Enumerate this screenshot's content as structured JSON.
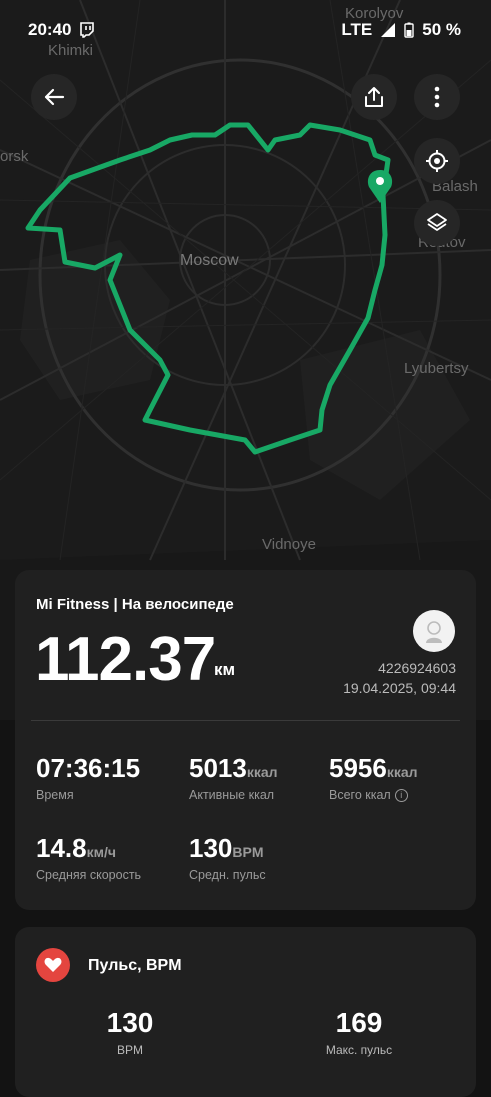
{
  "status_bar": {
    "time": "20:40",
    "network": "LTE",
    "battery": "50 %"
  },
  "map": {
    "labels": {
      "korolyov": "Korolyov",
      "khimki": "Khimki",
      "orsk": "orsk",
      "balash": "Balash",
      "reutov": "Reutov",
      "moscow": "Moscow",
      "lyubertsy": "Lyubertsy",
      "vidnoye": "Vidnoye"
    },
    "route_color": "#18a865",
    "pin_color": "#18a865"
  },
  "workout": {
    "title": "Mi Fitness | На велосипеде",
    "distance": "112.37",
    "distance_unit": "км",
    "user_id": "4226924603",
    "datetime": "19.04.2025, 09:44",
    "metrics": [
      {
        "value": "07:36:15",
        "unit": "",
        "label": "Время"
      },
      {
        "value": "5013",
        "unit": "ккал",
        "label": "Активные ккал"
      },
      {
        "value": "5956",
        "unit": "ккал",
        "label": "Всего ккал"
      },
      {
        "value": "14.8",
        "unit": "км/ч",
        "label": "Средняя скорость"
      },
      {
        "value": "130",
        "unit": "BPM",
        "label": "Средн. пульс"
      }
    ]
  },
  "heart_rate": {
    "title": "Пульс, BPM",
    "stats": [
      {
        "value": "130",
        "label": "BPM"
      },
      {
        "value": "169",
        "label": "Макс. пульс"
      }
    ],
    "accent": "#e4453f"
  }
}
